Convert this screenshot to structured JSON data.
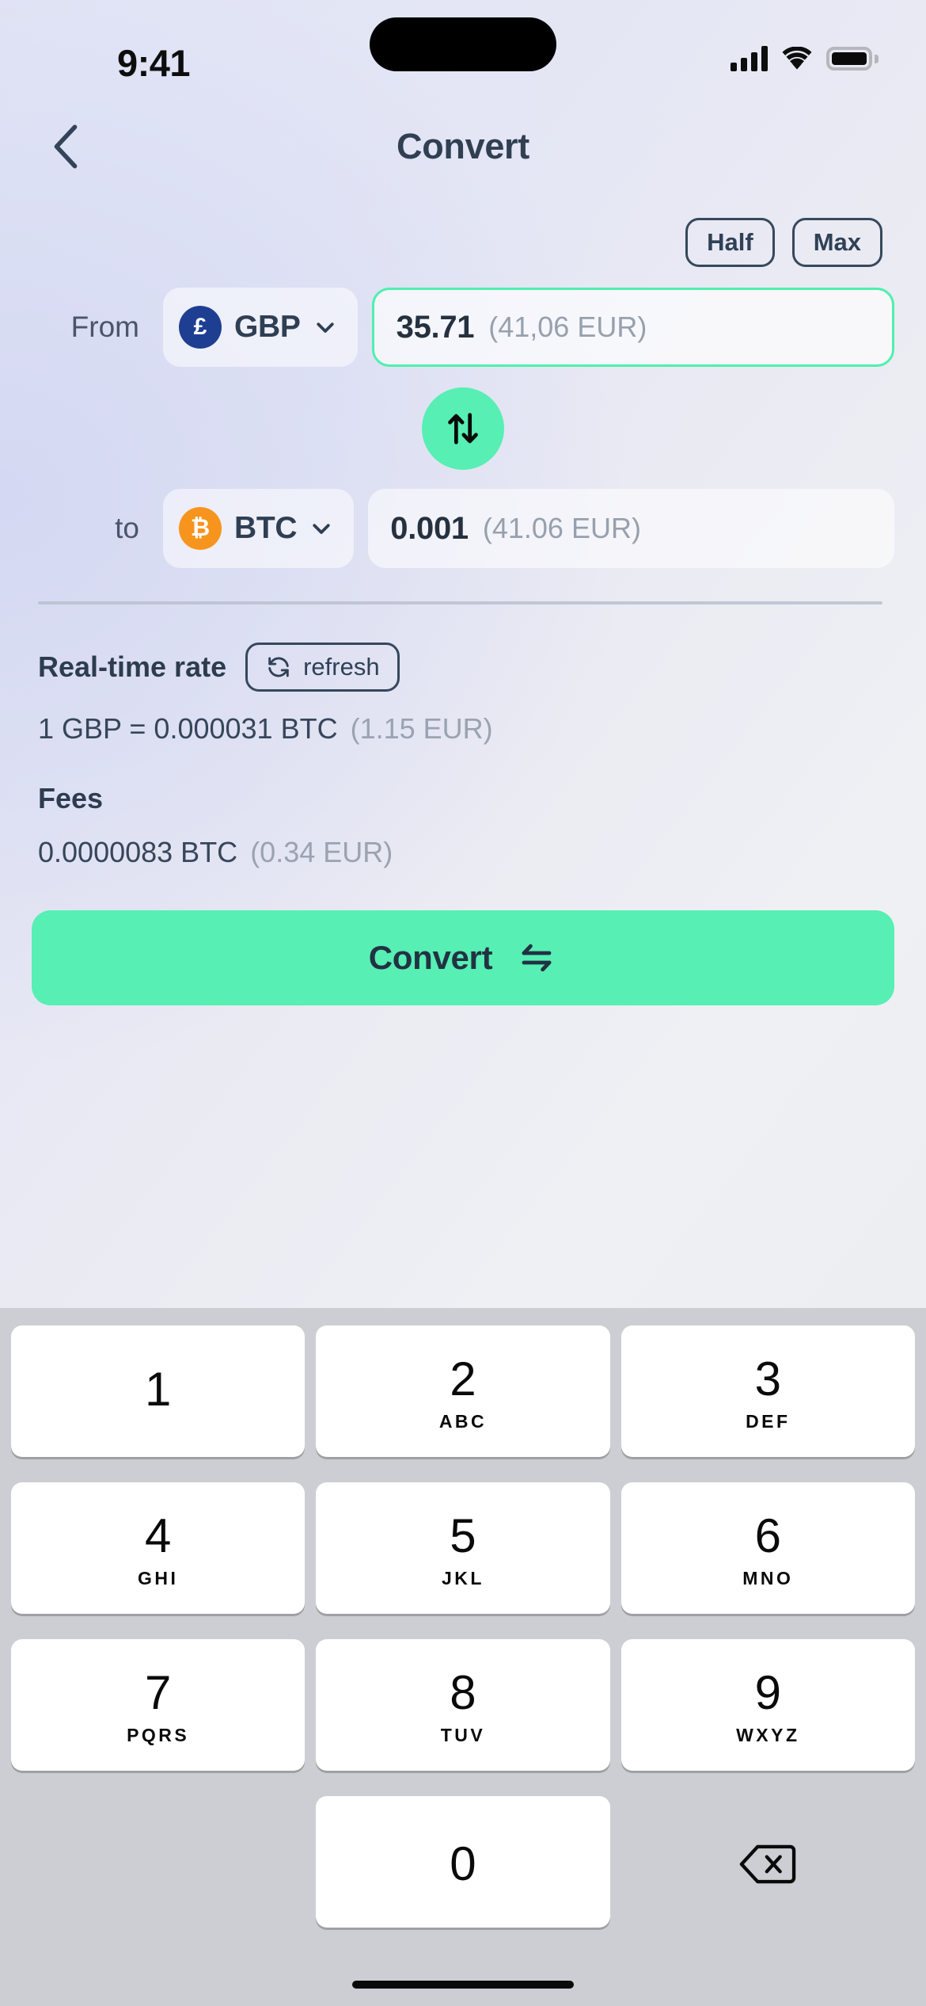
{
  "status_bar": {
    "time": "9:41",
    "signal_icon": "cellular-signal-icon",
    "wifi_icon": "wifi-icon",
    "battery_icon": "battery-full-icon"
  },
  "nav": {
    "back_icon": "chevron-left-icon",
    "title": "Convert"
  },
  "quick_actions": [
    {
      "label": "Half",
      "name": "half-button"
    },
    {
      "label": "Max",
      "name": "max-button"
    }
  ],
  "from": {
    "label": "From",
    "currency_code": "GBP",
    "currency_symbol": "£",
    "currency_color": "#1e3f91",
    "chevron_icon": "chevron-down-icon",
    "amount": "35.71",
    "secondary": "(41,06 EUR)"
  },
  "swap": {
    "icon": "swap-vertical-arrows-icon",
    "color": "#57efb3"
  },
  "to": {
    "label": "to",
    "currency_code": "BTC",
    "currency_symbol": "₿",
    "currency_color": "#f7941d",
    "chevron_icon": "chevron-down-icon",
    "amount": "0.001",
    "secondary": "(41.06 EUR)"
  },
  "rate": {
    "title": "Real-time rate",
    "refresh_label": "refresh",
    "refresh_icon": "refresh-circular-arrows-icon",
    "value": "1 GBP = 0.000031 BTC",
    "value_secondary": "(1.15 EUR)"
  },
  "fees": {
    "title": "Fees",
    "value": "0.0000083 BTC",
    "value_secondary": "(0.34 EUR)"
  },
  "cta": {
    "label": "Convert",
    "icon": "exchange-horizontal-arrows-icon",
    "color": "#57efb3"
  },
  "keypad": {
    "rows": [
      [
        {
          "num": "1",
          "letters": ""
        },
        {
          "num": "2",
          "letters": "ABC"
        },
        {
          "num": "3",
          "letters": "DEF"
        }
      ],
      [
        {
          "num": "4",
          "letters": "GHI"
        },
        {
          "num": "5",
          "letters": "JKL"
        },
        {
          "num": "6",
          "letters": "MNO"
        }
      ],
      [
        {
          "num": "7",
          "letters": "PQRS"
        },
        {
          "num": "8",
          "letters": "TUV"
        },
        {
          "num": "9",
          "letters": "WXYZ"
        }
      ]
    ],
    "zero": {
      "num": "0",
      "letters": ""
    },
    "backspace_icon": "backspace-delete-icon"
  }
}
